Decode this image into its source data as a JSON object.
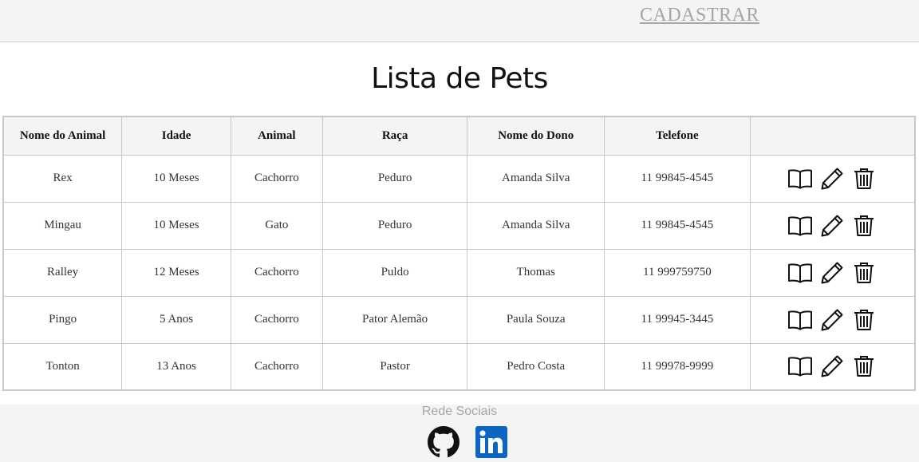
{
  "header": {
    "cadastrar_label": "CADASTRAR"
  },
  "page": {
    "title": "Lista de Pets"
  },
  "table": {
    "columns": [
      "Nome do Animal",
      "Idade",
      "Animal",
      "Raça",
      "Nome do Dono",
      "Telefone",
      ""
    ],
    "rows": [
      {
        "nome": "Rex",
        "idade": "10 Meses",
        "animal": "Cachorro",
        "raca": "Peduro",
        "dono": "Amanda Silva",
        "telefone": "11 99845-4545"
      },
      {
        "nome": "Mingau",
        "idade": "10 Meses",
        "animal": "Gato",
        "raca": "Peduro",
        "dono": "Amanda Silva",
        "telefone": "11 99845-4545"
      },
      {
        "nome": "Ralley",
        "idade": "12 Meses",
        "animal": "Cachorro",
        "raca": "Puldo",
        "dono": "Thomas",
        "telefone": "11 999759750"
      },
      {
        "nome": "Pingo",
        "idade": "5 Anos",
        "animal": "Cachorro",
        "raca": "Pator Alemão",
        "dono": "Paula Souza",
        "telefone": "11 99945-3445"
      },
      {
        "nome": "Tonton",
        "idade": "13 Anos",
        "animal": "Cachorro",
        "raca": "Pastor",
        "dono": "Pedro Costa",
        "telefone": "11 99978-9999"
      }
    ],
    "row_action_icons": [
      "book-icon",
      "pencil-icon",
      "trash-icon"
    ]
  },
  "footer": {
    "label": "Rede Sociais",
    "icons": [
      "github-icon",
      "linkedin-icon"
    ],
    "linkedin_color": "#0a66c2"
  }
}
